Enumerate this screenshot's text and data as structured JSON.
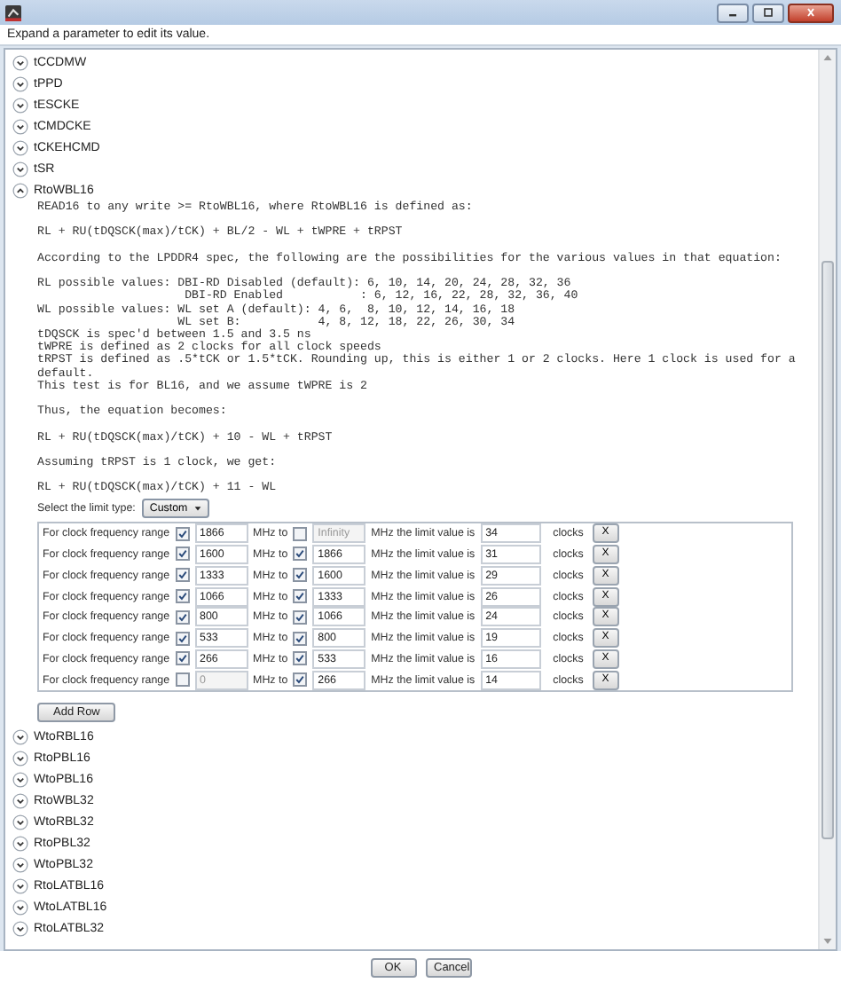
{
  "hint": "Expand a parameter to edit its value.",
  "parameters": [
    {
      "name": "tCCDMW",
      "expanded": false
    },
    {
      "name": "tPPD",
      "expanded": false
    },
    {
      "name": "tESCKE",
      "expanded": false
    },
    {
      "name": "tCMDCKE",
      "expanded": false
    },
    {
      "name": "tCKEHCMD",
      "expanded": false
    },
    {
      "name": "tSR",
      "expanded": false
    },
    {
      "name": "RtoWBL16",
      "expanded": true,
      "description": [
        "READ16 to any write >= RtoWBL16, where RtoWBL16 is defined as:",
        "RL + RU(tDQSCK(max)/tCK) + BL/2 - WL + tWPRE + tRPST",
        "According to the LPDDR4 spec, the following are the possibilities for the various values in that equation:",
        "RL possible values: DBI-RD Disabled (default): 6, 10, 14, 20, 24, 28, 32, 36\n                     DBI-RD Enabled           : 6, 12, 16, 22, 28, 32, 36, 40\nWL possible values: WL set A (default): 4, 6,  8, 10, 12, 14, 16, 18\n                    WL set B:           4, 8, 12, 18, 22, 26, 30, 34\ntDQSCK is spec'd between 1.5 and 3.5 ns\ntWPRE is defined as 2 clocks for all clock speeds\ntRPST is defined as .5*tCK or 1.5*tCK. Rounding up, this is either 1 or 2 clocks. Here 1 clock is used for a\ndefault.\nThis test is for BL16, and we assume tWPRE is 2",
        "Thus, the equation becomes:",
        "RL + RU(tDQSCK(max)/tCK) + 10 - WL + tRPST",
        "Assuming tRPST is 1 clock, we get:",
        "RL + RU(tDQSCK(max)/tCK) + 11 - WL"
      ],
      "limit_type": {
        "label": "Select the limit type:",
        "value": "Custom"
      },
      "limits": [
        {
          "from_label": "For clock frequency range",
          "from_checked": true,
          "from": "1866",
          "to_label": "MHz to",
          "to_checked": false,
          "to": "Infinity",
          "value_label": "MHz the limit value is",
          "value": "34",
          "unit": "clocks",
          "remove": "X"
        },
        {
          "from_label": "For clock frequency range",
          "from_checked": true,
          "from": "1600",
          "to_label": "MHz to",
          "to_checked": true,
          "to": "1866",
          "value_label": "MHz the limit value is",
          "value": "31",
          "unit": "clocks",
          "remove": "X"
        },
        {
          "from_label": "For clock frequency range",
          "from_checked": true,
          "from": "1333",
          "to_label": "MHz to",
          "to_checked": true,
          "to": "1600",
          "value_label": "MHz the limit value is",
          "value": "29",
          "unit": "clocks",
          "remove": "X"
        },
        {
          "from_label": "For clock frequency range",
          "from_checked": true,
          "from": "1066",
          "to_label": "MHz to",
          "to_checked": true,
          "to": "1333",
          "value_label": "MHz the limit value is",
          "value": "26",
          "unit": "clocks",
          "remove": "X"
        },
        {
          "from_label": "For clock frequency range",
          "from_checked": true,
          "from": "800",
          "to_label": "MHz to",
          "to_checked": true,
          "to": "1066",
          "value_label": "MHz the limit value is",
          "value": "24",
          "unit": "clocks",
          "remove": "X"
        },
        {
          "from_label": "For clock frequency range",
          "from_checked": true,
          "from": "533",
          "to_label": "MHz to",
          "to_checked": true,
          "to": "800",
          "value_label": "MHz the limit value is",
          "value": "19",
          "unit": "clocks",
          "remove": "X"
        },
        {
          "from_label": "For clock frequency range",
          "from_checked": true,
          "from": "266",
          "to_label": "MHz to",
          "to_checked": true,
          "to": "533",
          "value_label": "MHz the limit value is",
          "value": "16",
          "unit": "clocks",
          "remove": "X"
        },
        {
          "from_label": "For clock frequency range",
          "from_checked": false,
          "from": "0",
          "to_label": "MHz to",
          "to_checked": true,
          "to": "266",
          "value_label": "MHz the limit value is",
          "value": "14",
          "unit": "clocks",
          "remove": "X"
        }
      ],
      "add_button": "Add Row"
    },
    {
      "name": "WtoRBL16",
      "expanded": false
    },
    {
      "name": "RtoPBL16",
      "expanded": false
    },
    {
      "name": "WtoPBL16",
      "expanded": false
    },
    {
      "name": "RtoWBL32",
      "expanded": false
    },
    {
      "name": "WtoRBL32",
      "expanded": false
    },
    {
      "name": "RtoPBL32",
      "expanded": false
    },
    {
      "name": "WtoPBL32",
      "expanded": false
    },
    {
      "name": "RtoLATBL16",
      "expanded": false
    },
    {
      "name": "WtoLATBL16",
      "expanded": false
    },
    {
      "name": "RtoLATBL32",
      "expanded": false
    }
  ],
  "buttons": [
    "OK",
    "Cancel"
  ]
}
